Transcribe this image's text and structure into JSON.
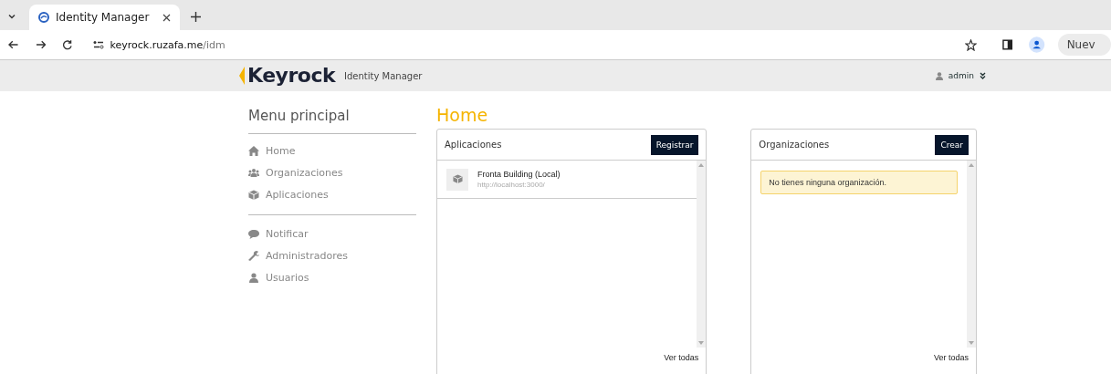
{
  "browser": {
    "tab_title": "Identity Manager",
    "url_host": "keyrock.ruzafa.me",
    "url_path": "/idm",
    "profile_chip": "Nuev"
  },
  "header": {
    "logo": "Keyrock",
    "subtitle": "Identity Manager",
    "user": "admin"
  },
  "menu": {
    "title": "Menu principal",
    "sections": [
      [
        {
          "label": "Home"
        },
        {
          "label": "Organizaciones"
        },
        {
          "label": "Aplicaciones"
        }
      ],
      [
        {
          "label": "Notificar"
        },
        {
          "label": "Administradores"
        },
        {
          "label": "Usuarios"
        }
      ]
    ]
  },
  "page_title": "Home",
  "panels": [
    {
      "title": "Aplicaciones",
      "button": "Registrar",
      "footer": "Ver todas",
      "items": [
        {
          "kind": "app",
          "name": "Fronta Building (Local)",
          "url": "http://localhost:3000/"
        }
      ]
    },
    {
      "title": "Organizaciones",
      "button": "Crear",
      "footer": "Ver todas",
      "items": [
        {
          "kind": "alert",
          "text": "No tienes ninguna organización."
        }
      ]
    }
  ]
}
